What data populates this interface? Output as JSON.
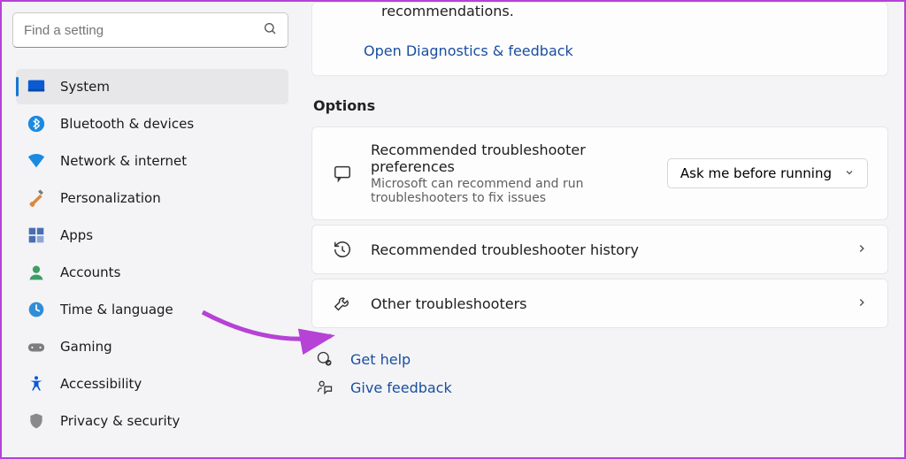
{
  "search": {
    "placeholder": "Find a setting"
  },
  "sidebar": {
    "items": [
      {
        "label": "System"
      },
      {
        "label": "Bluetooth & devices"
      },
      {
        "label": "Network & internet"
      },
      {
        "label": "Personalization"
      },
      {
        "label": "Apps"
      },
      {
        "label": "Accounts"
      },
      {
        "label": "Time & language"
      },
      {
        "label": "Gaming"
      },
      {
        "label": "Accessibility"
      },
      {
        "label": "Privacy & security"
      }
    ]
  },
  "main": {
    "top": {
      "recommendations_tail": "recommendations.",
      "diagnostics_link": "Open Diagnostics & feedback"
    },
    "options_heading": "Options",
    "pref": {
      "title": "Recommended troubleshooter preferences",
      "sub": "Microsoft can recommend and run troubleshooters to fix issues",
      "dropdown": "Ask me before running"
    },
    "history": {
      "title": "Recommended troubleshooter history"
    },
    "other": {
      "title": "Other troubleshooters"
    },
    "help": "Get help",
    "feedback": "Give feedback"
  }
}
